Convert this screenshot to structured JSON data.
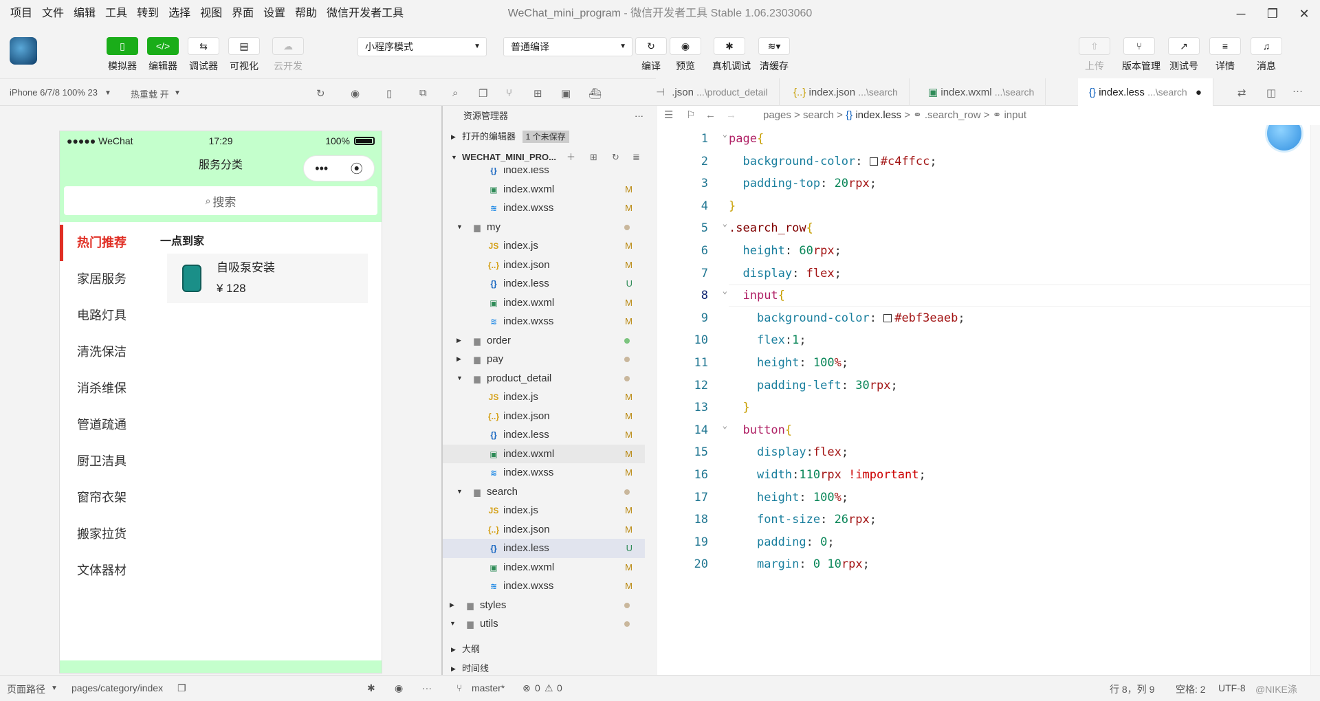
{
  "menubar": {
    "items": [
      "项目",
      "文件",
      "编辑",
      "工具",
      "转到",
      "选择",
      "视图",
      "界面",
      "设置",
      "帮助",
      "微信开发者工具"
    ],
    "window_title": "WeChat_mini_program",
    "window_subtitle": "- 微信开发者工具 Stable 1.06.2303060"
  },
  "toolbar": {
    "simulator": "模拟器",
    "editor": "编辑器",
    "debugger": "调试器",
    "visual": "可视化",
    "cloud": "云开发",
    "mode_select": "小程序模式",
    "compile_select": "普通编译",
    "compile": "编译",
    "preview": "预览",
    "real_debug": "真机调试",
    "clear_cache": "清缓存",
    "upload": "上传",
    "version_mgmt": "版本管理",
    "test_account": "测试号",
    "details": "详情",
    "messages": "消息"
  },
  "subbar": {
    "device": "iPhone 6/7/8 100% 23",
    "hot_reload": "热重载 开"
  },
  "phone": {
    "carrier": "●●●●● WeChat",
    "time": "17:29",
    "battery": "100%",
    "nav_title": "服务分类",
    "search_placeholder": "搜索",
    "categories": [
      "热门推荐",
      "家居服务",
      "电路灯具",
      "清洗保洁",
      "消杀维保",
      "管道疏通",
      "厨卫洁具",
      "窗帘衣架",
      "搬家拉货",
      "文体器材"
    ],
    "section_title": "一点到家",
    "goods_name": "自吸泵安装",
    "goods_price": "¥ 128"
  },
  "explorer": {
    "title": "资源管理器",
    "open_editors": "打开的编辑器",
    "unsaved": "1 个未保存",
    "project": "WECHAT_MINI_PRO...",
    "rows": [
      {
        "label": "index.less",
        "icon": "{}",
        "status": ""
      },
      {
        "label": "index.wxml",
        "icon": "<>",
        "status": "M"
      },
      {
        "label": "index.wxss",
        "icon": "3",
        "status": "M"
      },
      {
        "label": "my",
        "icon": "folder",
        "status": "dot"
      },
      {
        "label": "index.js",
        "icon": "JS",
        "status": "M"
      },
      {
        "label": "index.json",
        "icon": "{..}",
        "status": "M"
      },
      {
        "label": "index.less",
        "icon": "{}",
        "status": "U"
      },
      {
        "label": "index.wxml",
        "icon": "<>",
        "status": "M"
      },
      {
        "label": "index.wxss",
        "icon": "3",
        "status": "M"
      },
      {
        "label": "order",
        "icon": "folder",
        "status": "dotg"
      },
      {
        "label": "pay",
        "icon": "folder",
        "status": "dot"
      },
      {
        "label": "product_detail",
        "icon": "folder",
        "status": "dot"
      },
      {
        "label": "index.js",
        "icon": "JS",
        "status": "M"
      },
      {
        "label": "index.json",
        "icon": "{..}",
        "status": "M"
      },
      {
        "label": "index.less",
        "icon": "{}",
        "status": "M"
      },
      {
        "label": "index.wxml",
        "icon": "<>",
        "status": "M"
      },
      {
        "label": "index.wxss",
        "icon": "3",
        "status": "M"
      },
      {
        "label": "search",
        "icon": "folder",
        "status": "dot"
      },
      {
        "label": "index.js",
        "icon": "JS",
        "status": "M"
      },
      {
        "label": "index.json",
        "icon": "{..}",
        "status": "M"
      },
      {
        "label": "index.less",
        "icon": "{}",
        "status": "U"
      },
      {
        "label": "index.wxml",
        "icon": "<>",
        "status": "M"
      },
      {
        "label": "index.wxss",
        "icon": "3",
        "status": "M"
      },
      {
        "label": "styles",
        "icon": "folder",
        "status": "dot"
      },
      {
        "label": "utils",
        "icon": "folder",
        "status": "dot"
      }
    ],
    "outline": "大纲",
    "timeline": "时间线"
  },
  "tabs": [
    {
      "name": ".json",
      "path": "...\\product_detail"
    },
    {
      "name": "index.json",
      "path": "...\\search"
    },
    {
      "name": "index.wxml",
      "path": "...\\search"
    },
    {
      "name": "index.less",
      "path": "...\\search"
    }
  ],
  "breadcrumb": {
    "pages": "pages",
    "search": "search",
    "file": "index.less",
    "rule": ".search_row",
    "sub": "input"
  },
  "code": [
    {
      "n": "1",
      "t": "page{"
    },
    {
      "n": "2",
      "t": "  background-color: #c4ffcc;"
    },
    {
      "n": "3",
      "t": "  padding-top: 20rpx;"
    },
    {
      "n": "4",
      "t": "}"
    },
    {
      "n": "5",
      "t": ".search_row{"
    },
    {
      "n": "6",
      "t": "  height: 60rpx;"
    },
    {
      "n": "7",
      "t": "  display: flex;"
    },
    {
      "n": "8",
      "t": "  input{"
    },
    {
      "n": "9",
      "t": "    background-color: #ebf3eaeb;"
    },
    {
      "n": "10",
      "t": "    flex:1;"
    },
    {
      "n": "11",
      "t": "    height: 100%;"
    },
    {
      "n": "12",
      "t": "    padding-left: 30rpx;"
    },
    {
      "n": "13",
      "t": "  }"
    },
    {
      "n": "14",
      "t": "  button{"
    },
    {
      "n": "15",
      "t": "    display:flex;"
    },
    {
      "n": "16",
      "t": "    width:110rpx !important;"
    },
    {
      "n": "17",
      "t": "    height: 100%;"
    },
    {
      "n": "18",
      "t": "    font-size: 26rpx;"
    },
    {
      "n": "19",
      "t": "    padding: 0;"
    },
    {
      "n": "20",
      "t": "    margin: 0 10rpx;"
    }
  ],
  "statusbar": {
    "page_path_label": "页面路径",
    "page_path": "pages/category/index",
    "branch": "master*",
    "errors": "0",
    "warnings": "0",
    "cursor": "行 8，列 9",
    "spaces": "空格: 2",
    "encoding": "UTF-8",
    "lang": "@NIKE涤"
  },
  "colors": {
    "accent_green": "#1aad19",
    "phone_bg": "#c4ffcc",
    "active_red": "#e02e24"
  }
}
